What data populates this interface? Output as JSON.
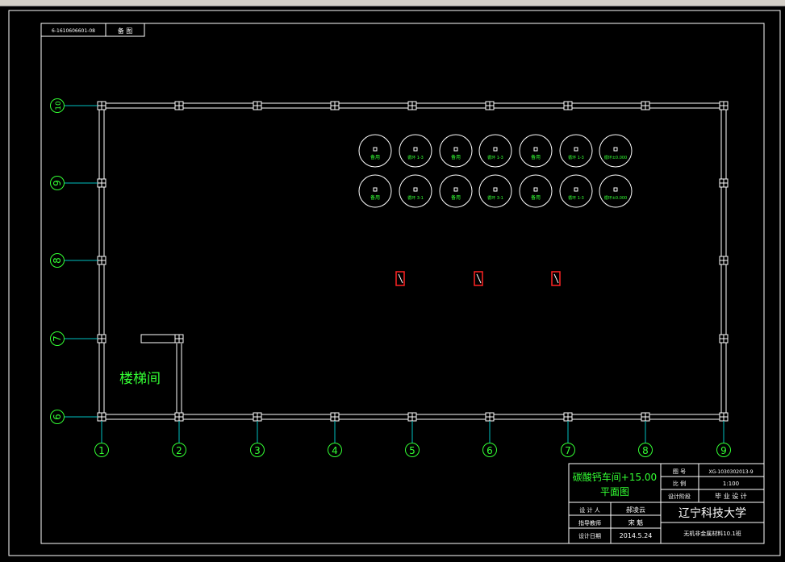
{
  "drawing": {
    "code_box": {
      "code": "6-1610606601-08",
      "label": "备 图"
    },
    "row_axes": [
      "10",
      "9",
      "8",
      "7",
      "6"
    ],
    "column_axes": [
      "1",
      "2",
      "3",
      "4",
      "5",
      "6",
      "7",
      "8",
      "9"
    ],
    "room_label": "楼梯间",
    "equipment": {
      "row1": [
        "备用",
        "循环 1-3",
        "备用",
        "循环 1-3",
        "备用",
        "循环 1-3",
        "循环±0.000"
      ],
      "row2": [
        "备用",
        "循环 3-1",
        "备用",
        "循环 3-1",
        "备用",
        "循环 1-3",
        "循环±0.000"
      ]
    }
  },
  "title_block": {
    "title_line1": "碳酸钙车间+15.00",
    "title_line2": "平面图",
    "drawing_no_label": "图 号",
    "drawing_no_value": "XG-1030302013-9",
    "scale_label": "比 例",
    "scale_value": "1:100",
    "stage_label": "设计阶段",
    "stage_value": "毕 业 设 计",
    "designer_label": "设 计 人",
    "designer_value": "郝凌云",
    "advisor_label": "指导教师",
    "advisor_value": "宋 魁",
    "date_label": "设计日期",
    "date_value": "2014.5.24",
    "school": "辽宁科技大学",
    "class_name": "无机非金属材料10.1班"
  },
  "colors": {
    "background": "#000000",
    "line": "#ffffff",
    "label": "#33ff33",
    "axis_line": "#00c0c0",
    "marker": "#ff2222"
  }
}
